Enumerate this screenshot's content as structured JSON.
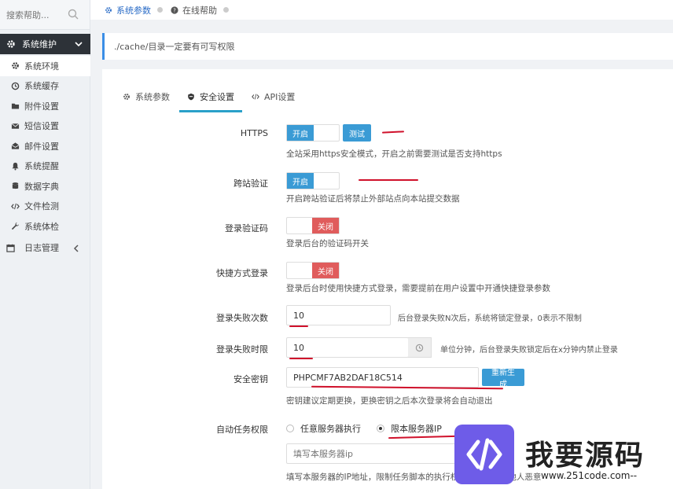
{
  "sidebar": {
    "search_placeholder": "搜索帮助...",
    "group_title": "系统维护",
    "items": [
      {
        "label": "系统环境",
        "icon": "gear-icon"
      },
      {
        "label": "系统缓存",
        "icon": "clock-icon"
      },
      {
        "label": "附件设置",
        "icon": "folder-icon"
      },
      {
        "label": "短信设置",
        "icon": "envelope-icon"
      },
      {
        "label": "邮件设置",
        "icon": "open-envelope-icon"
      },
      {
        "label": "系统提醒",
        "icon": "bell-icon"
      },
      {
        "label": "数据字典",
        "icon": "database-icon"
      },
      {
        "label": "文件检测",
        "icon": "code-icon"
      },
      {
        "label": "系统体检",
        "icon": "wrench-icon"
      }
    ],
    "collapsed_group": {
      "label": "日志管理",
      "icon": "calendar-icon"
    }
  },
  "topnav": {
    "tabs": [
      {
        "label": "系统参数",
        "icon": "gear-icon"
      },
      {
        "label": "在线帮助",
        "icon": "question-icon"
      }
    ]
  },
  "notice": "./cache/目录一定要有可写权限",
  "tabs": [
    {
      "label": "系统参数",
      "icon": "gear-icon"
    },
    {
      "label": "安全设置",
      "icon": "shield-icon"
    },
    {
      "label": "API设置",
      "icon": "code-icon"
    }
  ],
  "form": {
    "https": {
      "label": "HTTPS",
      "switch_on": "开启",
      "test_button": "测试",
      "help": "全站采用https安全模式，开启之前需要测试是否支持https"
    },
    "csrf": {
      "label": "跨站验证",
      "switch_on": "开启",
      "help": "开启跨站验证后将禁止外部站点向本站提交数据"
    },
    "captcha": {
      "label": "登录验证码",
      "switch_off": "关闭",
      "help": "登录后台的验证码开关"
    },
    "quick_login": {
      "label": "快捷方式登录",
      "switch_off": "关闭",
      "help": "登录后台时使用快捷方式登录，需要提前在用户设置中开通快捷登录参数"
    },
    "fail_count": {
      "label": "登录失败次数",
      "value": "10",
      "help": "后台登录失败N次后，系统将锁定登录，0表示不限制"
    },
    "fail_time": {
      "label": "登录失败时限",
      "value": "10",
      "help": "单位分钟，后台登录失败锁定后在x分钟内禁止登录"
    },
    "secret": {
      "label": "安全密钥",
      "value": "PHPCMF7AB2DAF18C514",
      "regen_button": "重新生成",
      "help": "密钥建议定期更换，更换密钥之后本次登录将会自动退出"
    },
    "cron": {
      "label": "自动任务权限",
      "options": [
        "任意服务器执行",
        "限本服务器IP"
      ],
      "selected": 1,
      "ip_placeholder": "填写本服务器ip",
      "help": "填写本服务器的IP地址，限制任务脚本的执行权限，防止被其他人恶意"
    }
  },
  "watermark": {
    "title": "我要源码",
    "url": "www.251code.com--"
  },
  "colors": {
    "accent": "#3a9bd5",
    "danger": "#e05c5c",
    "sidebar_dark": "#2d3238",
    "annotation": "#d0112b"
  }
}
